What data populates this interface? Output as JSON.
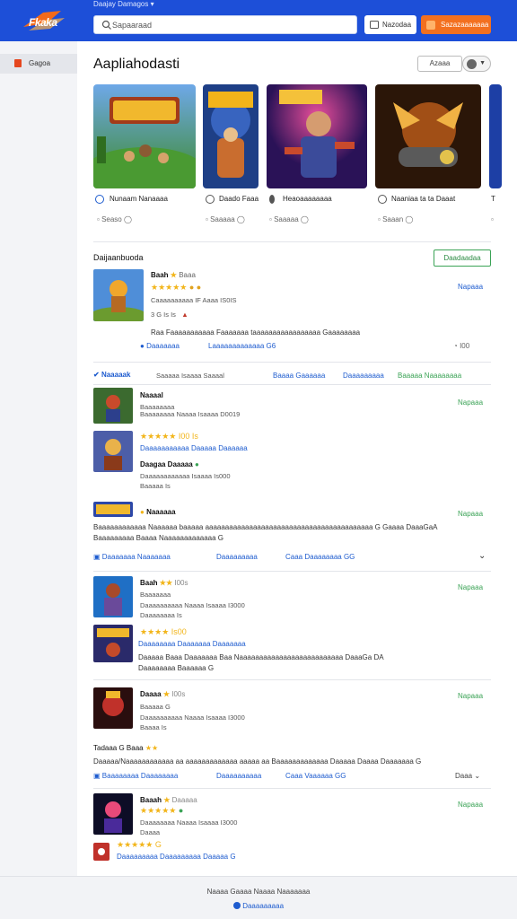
{
  "header": {
    "logo": "Fkaka",
    "top_links": "Daajay  Damagos  ▾",
    "search_placeholder": "Sapaaraad",
    "btn_secondary": "Nazodaa",
    "btn_primary": "Sazazaaaaaaa"
  },
  "sidebar": {
    "items": [
      {
        "label": "Gagoa"
      }
    ]
  },
  "main": {
    "title": "Aapliahodasti",
    "sort_label": "Azaaa",
    "featured": [
      {
        "title": "Nunaam Nanaaaa",
        "meta": "Seaso",
        "art": "green"
      },
      {
        "title": "Daado Faaa",
        "meta": "Saaaaa",
        "art": "blue"
      },
      {
        "title": "Heaoaaaaaaaa",
        "meta": "Saaaaa",
        "art": "purple"
      },
      {
        "title": "Naaniaa ta ta Daaat",
        "meta": "Saaan",
        "art": "orange"
      },
      {
        "title": "T",
        "meta": "",
        "art": "blue2"
      }
    ],
    "section1": {
      "title": "Daijaanbuoda",
      "button": "Daadaadaa",
      "item": {
        "name": "Baah",
        "rating_text": "Baaa",
        "sub1": "Caaaaaaaaaa  IF  Aaaa   IS0IS",
        "sub2": "3 G  Is  Is",
        "description": "Raa  Faaaaaaaaaaa  Faaaaaaa  taaaaaaaaaaaaaaaaa  Gaaaaaaaa",
        "link1": "Daaaaaaa",
        "link2": "Laaaaaaaaaaaaa  G6",
        "side": "Napaaa",
        "count": "I00"
      }
    },
    "section2": {
      "tab1": "Naaaaak",
      "tab1_sub": "Saaaaa Isaaaa Saaaal",
      "tab2": "Baaaa Gaaaaaa",
      "tab3": "Daaaaaaaaa",
      "tab4": "Baaaaa Naaaaaaaa",
      "items": [
        {
          "name": "Naaaal",
          "sub1": "Baaaaaaaa",
          "sub2": "Baaaaaaaa  Naaaa  Isaaaa   D0019",
          "side": "Napaaa"
        },
        {
          "name": "Daaaaaaaaaaa Daaaaa Daaaaaa",
          "stars": "★★★★★ I00 Is",
          "sub1": "Daagaa  Daaaaa",
          "sub2": "Daaaaaaaaaaaa  Isaaaa   Is000",
          "sub3": "Baaaaa    Is"
        },
        {
          "name": "Naaaaaa",
          "side": "Napaaa",
          "desc1": "Baaaaaaaaaaaa  Naaaaaa  baaaaa  aaaaaaaaaaaaaaaaaaaaaaaaaaaaaaaaaaaaaaaaaa  G Gaaaa  DaaaGaA",
          "desc2": "Baaaaaaaaa  Baaaa  Naaaaaaaaaaaaa  G"
        },
        {
          "link1": "Daaaaaaa  Naaaaaaa",
          "link2": "Daaaaaaaaa",
          "link3": "Caaa  Daaaaaaaa  GG"
        }
      ]
    },
    "section3": {
      "items": [
        {
          "name": "Baah",
          "rating": "I00s",
          "sub1": "Baaaaaaa",
          "sub2": "Daaaaaaaaaa  Naaaa  Isaaaa   I3000",
          "sub3": "Daaaaaaaa   Is",
          "side": "Napaaa"
        },
        {
          "name": "Daaaaaaaa Daaaaaaa Daaaaaaa",
          "stars": "★★★★ Is00",
          "desc1": "Daaaaa  Baaa  Daaaaaaa  Baa  Naaaaaaaaaaaaaaaaaaaaaaaaaa  DaaaGa  DA",
          "desc2": "Daaaaaaaa  Baaaaaa  G"
        },
        {
          "name": "Daaaa",
          "rating": "I00s",
          "sub1": "Baaaaa   G",
          "sub2": "Daaaaaaaaaa  Naaaa  Isaaaa   I3000",
          "sub3": "Baaaa    Is",
          "side": "Napaaa"
        },
        {
          "name": "Tadaaa  G  Baaa",
          "desc": "Daaaaa/Naaaaaaaaaaaa  aa  aaaaaaaaaaaaa  aaaaa  aa  Baaaaaaaaaaaaa  Daaaaa  Daaaa  Daaaaaaa  G"
        },
        {
          "link1": "Baaaaaaaa  Daaaaaaaa",
          "link2": "Daaaaaaaaaa",
          "link3": "Caaa  Vaaaaaa  GG",
          "link4": "Daaa"
        }
      ]
    },
    "section4": {
      "items": [
        {
          "name": "Baaah",
          "rating": "Daaaaa",
          "sub1": "Daaaaaaaa  Naaaa  Isaaaa   I3000",
          "sub2": "Daaaa",
          "side": "Napaaa"
        },
        {
          "name": "Daaaaaaaaa  Daaaaaaaaa  Daaaaa  G",
          "stars": "★★★★★ G"
        }
      ]
    }
  },
  "footer": {
    "links": "Naaaa  Gaaaa  Naaaa   Naaaaaaa",
    "brand": "Daaaaaaaaa"
  }
}
